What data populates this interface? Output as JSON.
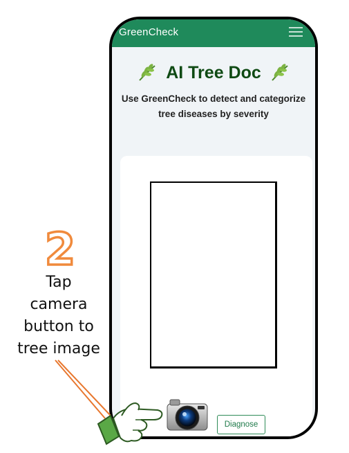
{
  "app": {
    "title": "GreenCheck",
    "menu_icon": "hamburger-menu-icon",
    "header_color": "#1f8a5b"
  },
  "hero": {
    "title": "AI Tree Doc",
    "leaf_icon": "herb-leaf-icon",
    "subtitle": "Use GreenCheck to detect and categorize tree diseases by severity",
    "title_color": "#0f4a14"
  },
  "upload": {
    "camera_icon": "camera-icon",
    "diagnose_label": "Diagnose"
  },
  "tutorial": {
    "step_number": "2",
    "step_color": "#f08a3c",
    "instruction_lines": [
      "Tap",
      "camera",
      "button to",
      "tree image"
    ],
    "pointer_icon": "pointing-hand-icon",
    "hand_color": "#5aa846"
  }
}
